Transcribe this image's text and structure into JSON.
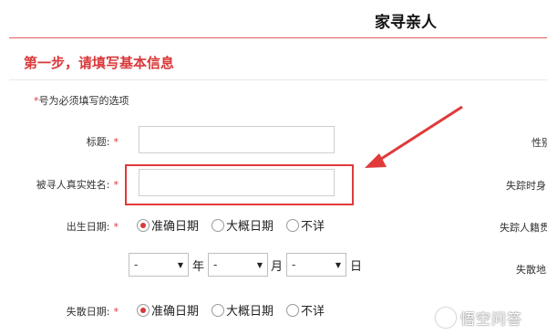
{
  "header": {
    "title": "家寻亲人"
  },
  "section": {
    "title": "第一步，请填写基本信息",
    "required_star": "*",
    "required_note": "号为必须填写的选项"
  },
  "form": {
    "title_label": "标题:",
    "name_label": "被寻人真实姓名:",
    "birth_label": "出生日期:",
    "lost_label": "失散日期:",
    "star": "*",
    "radio_options": [
      "准确日期",
      "大概日期",
      "不详"
    ],
    "selected_radio": "准确日期",
    "select_placeholder": "-",
    "units": [
      "年",
      "月",
      "日"
    ]
  },
  "right_column": {
    "labels": [
      "性别",
      "失踪时身",
      "失踪人籍贯",
      "失散地点"
    ]
  },
  "watermark": {
    "text": "悟空问答"
  },
  "colors": {
    "accent": "#d9393a",
    "highlight": "#e03a3a"
  }
}
